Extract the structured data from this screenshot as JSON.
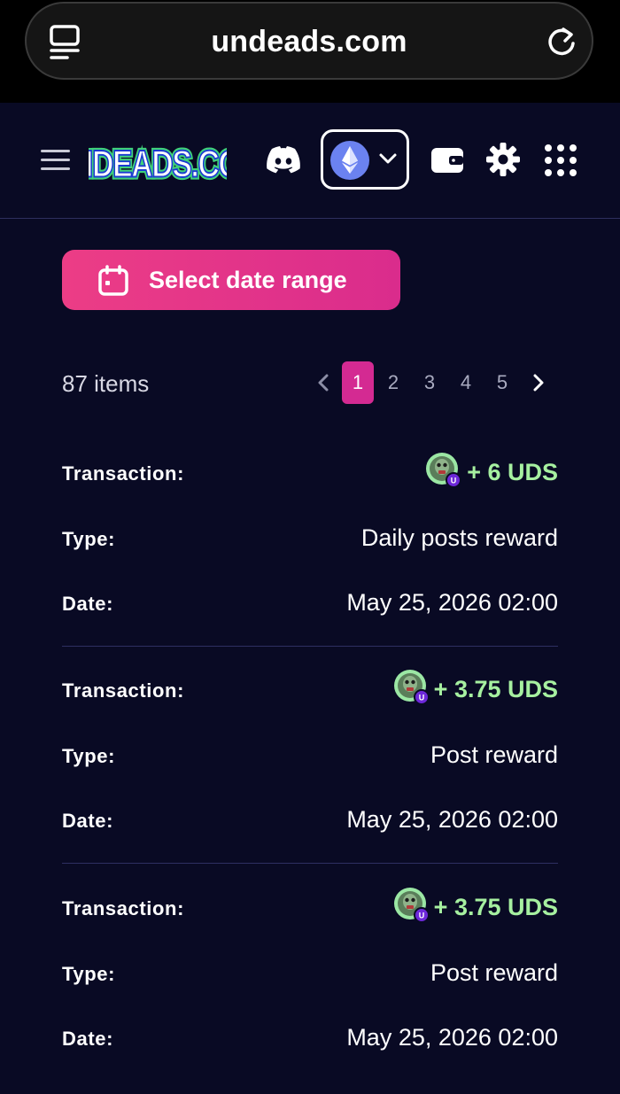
{
  "browser": {
    "url": "undeads.com"
  },
  "header": {
    "logo_text": "UNDEADS.COM",
    "icons": [
      "menu-icon",
      "discord-icon",
      "ethereum-icon",
      "chevron-down-icon",
      "wallet-icon",
      "gear-icon",
      "apps-grid-icon"
    ]
  },
  "filter": {
    "date_button_label": "Select date range"
  },
  "list": {
    "items_count": "87 items"
  },
  "pagination": {
    "pages": [
      "1",
      "2",
      "3",
      "4",
      "5"
    ],
    "current": "1"
  },
  "labels": {
    "transaction": "Transaction:",
    "type": "Type:",
    "date": "Date:"
  },
  "transactions": [
    {
      "amount": "+ 6 UDS",
      "type": "Daily posts reward",
      "date": "May 25, 2026 02:00"
    },
    {
      "amount": "+ 3.75 UDS",
      "type": "Post reward",
      "date": "May 25, 2026 02:00"
    },
    {
      "amount": "+ 3.75 UDS",
      "type": "Post reward",
      "date": "May 25, 2026 02:00"
    }
  ],
  "colors": {
    "background": "#090a24",
    "accent_pink": "#e1318a",
    "amount_green": "#a6f0a0",
    "avatar_badge": "#6d28d9"
  }
}
